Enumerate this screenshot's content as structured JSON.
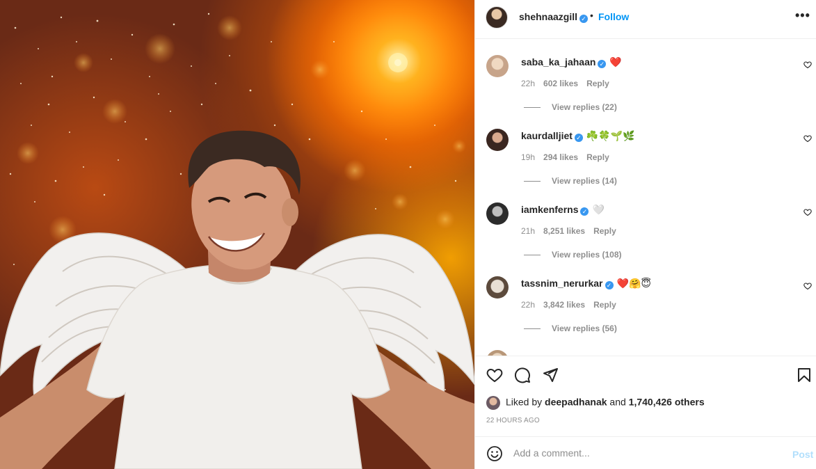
{
  "post": {
    "image_alt": "Smiling man in white t-shirt with angel wings on glowing orange background"
  },
  "header": {
    "username": "shehnaazgill",
    "verified": true,
    "dot": "•",
    "follow_label": "Follow",
    "more_label": "•••"
  },
  "comments": [
    {
      "username": "saba_ka_jahaan",
      "text": "❤️",
      "time": "22h",
      "likes": "602 likes",
      "reply": "Reply",
      "view_replies": "View replies (22)"
    },
    {
      "username": "kaurdalljiet",
      "text": "☘️🍀🌱🌿",
      "time": "19h",
      "likes": "294 likes",
      "reply": "Reply",
      "view_replies": "View replies (14)"
    },
    {
      "username": "iamkenferns",
      "text": "🤍",
      "time": "21h",
      "likes": "8,251 likes",
      "reply": "Reply",
      "view_replies": "View replies (108)"
    },
    {
      "username": "tassnim_nerurkar",
      "text": "❤️🤗😇",
      "time": "22h",
      "likes": "3,842 likes",
      "reply": "Reply",
      "view_replies": "View replies (56)"
    }
  ],
  "likes": {
    "prefix": "Liked by ",
    "first_liker": "deepadhanak",
    "middle": " and ",
    "others": "1,740,426 others"
  },
  "timestamp": "22 HOURS AGO",
  "add_comment": {
    "placeholder": "Add a comment...",
    "post_label": "Post"
  },
  "colors": {
    "link_blue": "#0095f6",
    "verified_blue": "#3897f0",
    "muted_text": "#8e8e8e",
    "post_disabled": "#b2dffc"
  }
}
